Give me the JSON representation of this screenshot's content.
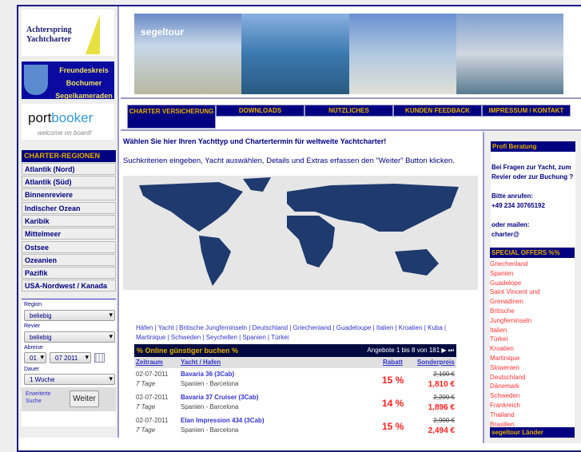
{
  "logos": {
    "achterspring": "Achterspring Yachtcharter",
    "freundeskreis": [
      "Freundeskreis",
      "Bochumer",
      "Segelkameraden"
    ],
    "portbooker": "portbooker.com welcome on board"
  },
  "regions": {
    "title": "CHARTER-REGIONEN",
    "items": [
      "Atlantik (Nord)",
      "Atlantik (Süd)",
      "Binnenreviere",
      "Indischer Ozean",
      "Karibik",
      "Mittelmeer",
      "Ostsee",
      "Ozeanien",
      "Pazifik",
      "USA-Nordwest / Kanada"
    ]
  },
  "search": {
    "region_label": "Region",
    "region_value": "beliebig",
    "revier_label": "Revier",
    "revier_value": "beliebig",
    "abreise_label": "Abreise",
    "day_value": "01",
    "month_value": "07 2011",
    "dauer_label": "Dauer",
    "dauer_value": "1 Woche",
    "advanced": [
      "Erweiterte",
      "Suche"
    ],
    "submit": "Weiter"
  },
  "banner": {
    "brand": "segeltour"
  },
  "nav": [
    "CHARTER VERSICHERUNG",
    "DOWNLOADS",
    "NÜTZLICHES",
    "KUNDEN FEEDBACK",
    "IMPRESSUM / KONTAKT"
  ],
  "intro": {
    "heading": "Wählen Sie hier Ihren Yachttyp und Chartertermin für weltweite Yachtcharter!",
    "text": "Suchkriterien eingeben, Yacht auswählen, Details und Extras erfassen den \"Weiter\" Button klicken."
  },
  "links": [
    "Häfen",
    "Yacht",
    "Britische Jungferninseln",
    "Deutschland",
    "Griechenland",
    "Guadeloupe",
    "Italien",
    "Kroatien",
    "Kuba",
    "Martinique",
    "Schweden",
    "Seychellen",
    "Spanien",
    "Türkei"
  ],
  "offers_table": {
    "title": "% Online günstiger buchen %",
    "paging": "Angebote 1 bis 8 von 181",
    "columns": [
      "Zeitraum",
      "Yacht / Hafen",
      "Rabatt",
      "Sonderpreis"
    ],
    "rows": [
      {
        "date": "02-07-2011",
        "duration": "7 Tage",
        "yacht": "Bavaria 36 (3Cab)",
        "port": "Spanien - Barcelona",
        "discount": "15 %",
        "old": "2,100 €",
        "price": "1,810 €"
      },
      {
        "date": "02-07-2011",
        "duration": "7 Tage",
        "yacht": "Bavaria 37 Cruiser (3Cab)",
        "port": "Spanien - Barcelona",
        "discount": "14 %",
        "old": "2,200 €",
        "price": "1,896 €"
      },
      {
        "date": "02-07-2011",
        "duration": "7 Tage",
        "yacht": "Elan Impression 434 (3Cab)",
        "port": "Spanien - Barcelona",
        "discount": "15 %",
        "old": "2,900 €",
        "price": "2,494 €"
      }
    ]
  },
  "right": {
    "beratung_title": "Profi Beratung",
    "beratung_text": "Bei Fragen zur Yacht, zum Revier oder zur Buchung ?",
    "call": "Bitte anrufen:",
    "phone": "+49 234 30765192",
    "mail": "oder mailen:",
    "email": "charter@",
    "special_title": "SPECIAL OFFERS %%",
    "special": [
      "Griechenland",
      "Spanien",
      "Guadelope",
      "Saint Vincent und",
      "Grenadinen",
      "Britische",
      "Jungferninseln",
      "Italien",
      "Türkei",
      "Kroatien",
      "Martinique",
      "Slowenien",
      "Deutschland",
      "Dänemark",
      "Schweden",
      "Frankreich",
      "Thailand",
      "Brasilien"
    ],
    "laender_title": "segeltour Länder"
  }
}
